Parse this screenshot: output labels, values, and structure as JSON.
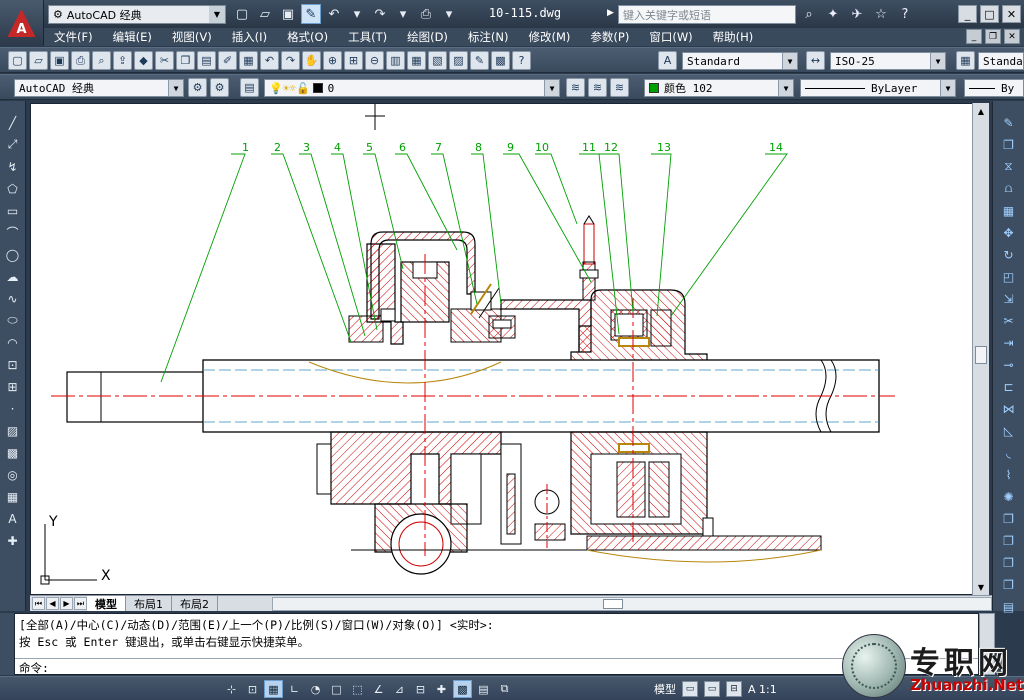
{
  "window": {
    "workspace": "AutoCAD 经典",
    "document_title": "10-115.dwg",
    "search_placeholder": "键入关键字或短语"
  },
  "menu": [
    "文件(F)",
    "编辑(E)",
    "视图(V)",
    "插入(I)",
    "格式(O)",
    "工具(T)",
    "绘图(D)",
    "标注(N)",
    "修改(M)",
    "参数(P)",
    "窗口(W)",
    "帮助(H)"
  ],
  "styles": {
    "text_style": "Standard",
    "dim_style": "ISO-25",
    "table_style": "Standa"
  },
  "layers": {
    "workspace": "AutoCAD 经典",
    "current_layer": "0",
    "color_label": "颜色 102",
    "linetype": "ByLayer",
    "lineweight": "By"
  },
  "drawing": {
    "part_numbers": [
      "1",
      "2",
      "3",
      "4",
      "5",
      "6",
      "7",
      "8",
      "9",
      "10",
      "11",
      "12",
      "13",
      "14"
    ],
    "ucs_x": "X",
    "ucs_y": "Y"
  },
  "tabs": [
    "模型",
    "布局1",
    "布局2"
  ],
  "command": {
    "line1": "[全部(A)/中心(C)/动态(D)/范围(E)/上一个(P)/比例(S)/窗口(W)/对象(O)] <实时>:",
    "line2": "按 Esc 或 Enter 键退出，或单击右键显示快捷菜单。",
    "prompt": "命令:"
  },
  "status": {
    "model": "模型",
    "scale": "A 1:1"
  },
  "watermark": {
    "name": "专职网",
    "url": "Zhuanzhi.Net"
  },
  "colors": {
    "leader_green": "#00a000",
    "hatch_red": "#cc0000",
    "center_red": "#e00000",
    "outline": "#000000",
    "highlight": "#b8860b"
  }
}
